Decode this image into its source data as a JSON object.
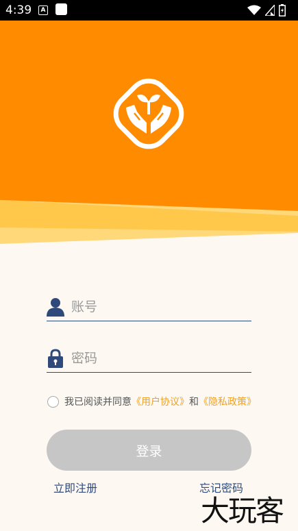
{
  "status_bar": {
    "time": "4:39",
    "notif_letter": "A"
  },
  "login_form": {
    "username_placeholder": "账号",
    "password_placeholder": "密码",
    "agree_prefix": "我已阅读并同意",
    "user_agreement": "《用户协议》",
    "conjunction": "和",
    "privacy_policy": "《隐私政策》",
    "login_label": "登录",
    "register_label": "立即注册",
    "forgot_label": "忘记密码"
  },
  "watermark": "大玩客",
  "colors": {
    "header_orange": "#ff8c00",
    "stripe_yellow": "#ffc84a",
    "stripe_light": "#ffd87a",
    "accent_link": "#f0a020",
    "field_line": "#2f4a7a",
    "button_disabled": "#c6c6c6"
  },
  "icons": {
    "logo": "hands-sprout-logo",
    "username": "user-icon",
    "password": "lock-icon",
    "wifi": "wifi-icon",
    "signal": "signal-icon",
    "battery": "battery-icon"
  }
}
